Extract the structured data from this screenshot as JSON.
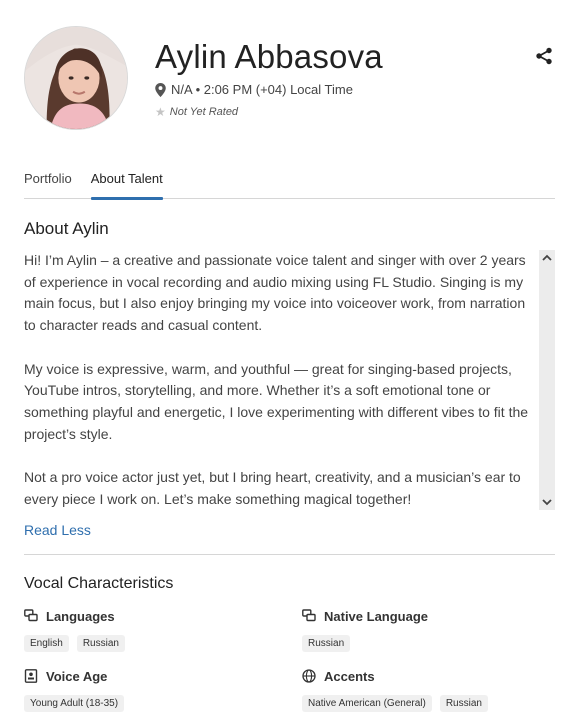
{
  "profile": {
    "name": "Aylin Abbasova",
    "location": "N/A • 2:06 PM (+04) Local Time",
    "rating": "Not Yet Rated"
  },
  "tabs": [
    {
      "label": "Portfolio",
      "active": false
    },
    {
      "label": "About Talent",
      "active": true
    }
  ],
  "about": {
    "title": "About Aylin",
    "paragraphs": [
      "Hi! I’m Aylin – a creative and passionate voice talent and singer with over 2 years of experience in vocal recording and audio mixing using FL Studio. Singing is my main focus, but I also enjoy bringing my voice into voiceover work, from narration to character reads and casual content.",
      "My voice is expressive, warm, and youthful — great for singing-based projects, YouTube intros, storytelling, and more. Whether it’s a soft emotional tone or something playful and energetic, I love experimenting with different vibes to fit the project’s style.",
      "Not a pro voice actor just yet, but I bring heart, creativity, and a musician’s ear to every piece I work on. Let’s make something magical together!"
    ],
    "toggle_label": "Read Less"
  },
  "vocal": {
    "title": "Vocal Characteristics",
    "languages": {
      "label": "Languages",
      "values": [
        "English",
        "Russian"
      ]
    },
    "native_language": {
      "label": "Native Language",
      "values": [
        "Russian"
      ]
    },
    "voice_age": {
      "label": "Voice Age",
      "values": [
        "Young Adult (18-35)"
      ]
    },
    "accents": {
      "label": "Accents",
      "values": [
        "Native American (General)",
        "Russian"
      ]
    }
  },
  "colors": {
    "accent": "#2f6fae",
    "chip_bg": "#f0f0f0"
  },
  "icons": [
    "share-icon",
    "location-pin-icon",
    "star-icon",
    "chat-bubbles-icon",
    "id-card-icon",
    "globe-icon",
    "chevron-up-icon",
    "chevron-down-icon"
  ]
}
